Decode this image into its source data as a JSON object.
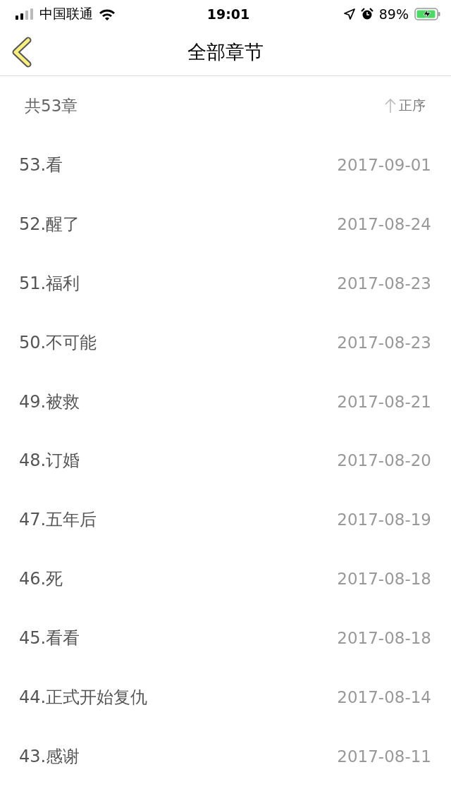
{
  "status_bar": {
    "carrier": "中国联通",
    "time": "19:01",
    "battery_percent": "89%"
  },
  "nav_bar": {
    "title": "全部章节"
  },
  "summary": {
    "count": "共53章",
    "sort_label": "正序"
  },
  "chapters": [
    {
      "title": "53.看",
      "date": "2017-09-01"
    },
    {
      "title": "52.醒了",
      "date": "2017-08-24"
    },
    {
      "title": "51.福利",
      "date": "2017-08-23"
    },
    {
      "title": "50.不可能",
      "date": "2017-08-23"
    },
    {
      "title": "49.被救",
      "date": "2017-08-21"
    },
    {
      "title": "48.订婚",
      "date": "2017-08-20"
    },
    {
      "title": "47.五年后",
      "date": "2017-08-19"
    },
    {
      "title": "46.死",
      "date": "2017-08-18"
    },
    {
      "title": "45.看看",
      "date": "2017-08-18"
    },
    {
      "title": "44.正式开始复仇",
      "date": "2017-08-14"
    },
    {
      "title": "43.感谢",
      "date": "2017-08-11"
    }
  ]
}
